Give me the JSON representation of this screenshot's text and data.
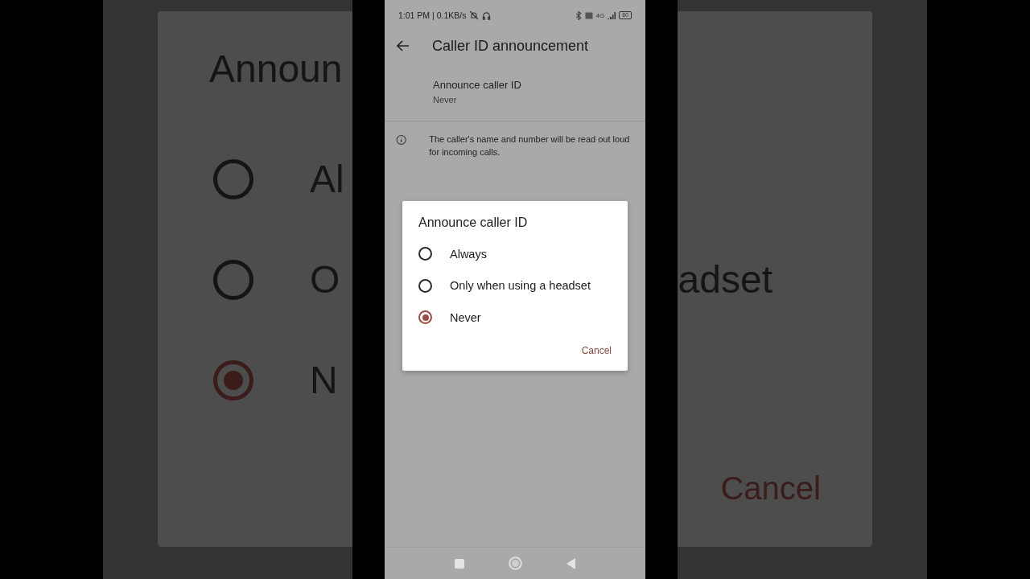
{
  "backdrop": {
    "title": "Announ",
    "options": [
      {
        "label": "Al",
        "selected": false
      },
      {
        "label": "O",
        "selected": false
      },
      {
        "label": "N",
        "selected": true
      }
    ],
    "fragment": "adset",
    "cancel": "Cancel"
  },
  "status_bar": {
    "time": "1:01 PM | 0.1KB/s",
    "network": "4G",
    "battery": "60"
  },
  "app_bar": {
    "title": "Caller ID announcement"
  },
  "setting": {
    "title": "Announce caller ID",
    "value": "Never"
  },
  "info": "The caller's name and number will be read out loud for incoming calls.",
  "dialog": {
    "title": "Announce caller ID",
    "options": [
      {
        "label": "Always",
        "selected": false
      },
      {
        "label": "Only when using a headset",
        "selected": false
      },
      {
        "label": "Never",
        "selected": true
      }
    ],
    "cancel": "Cancel"
  }
}
